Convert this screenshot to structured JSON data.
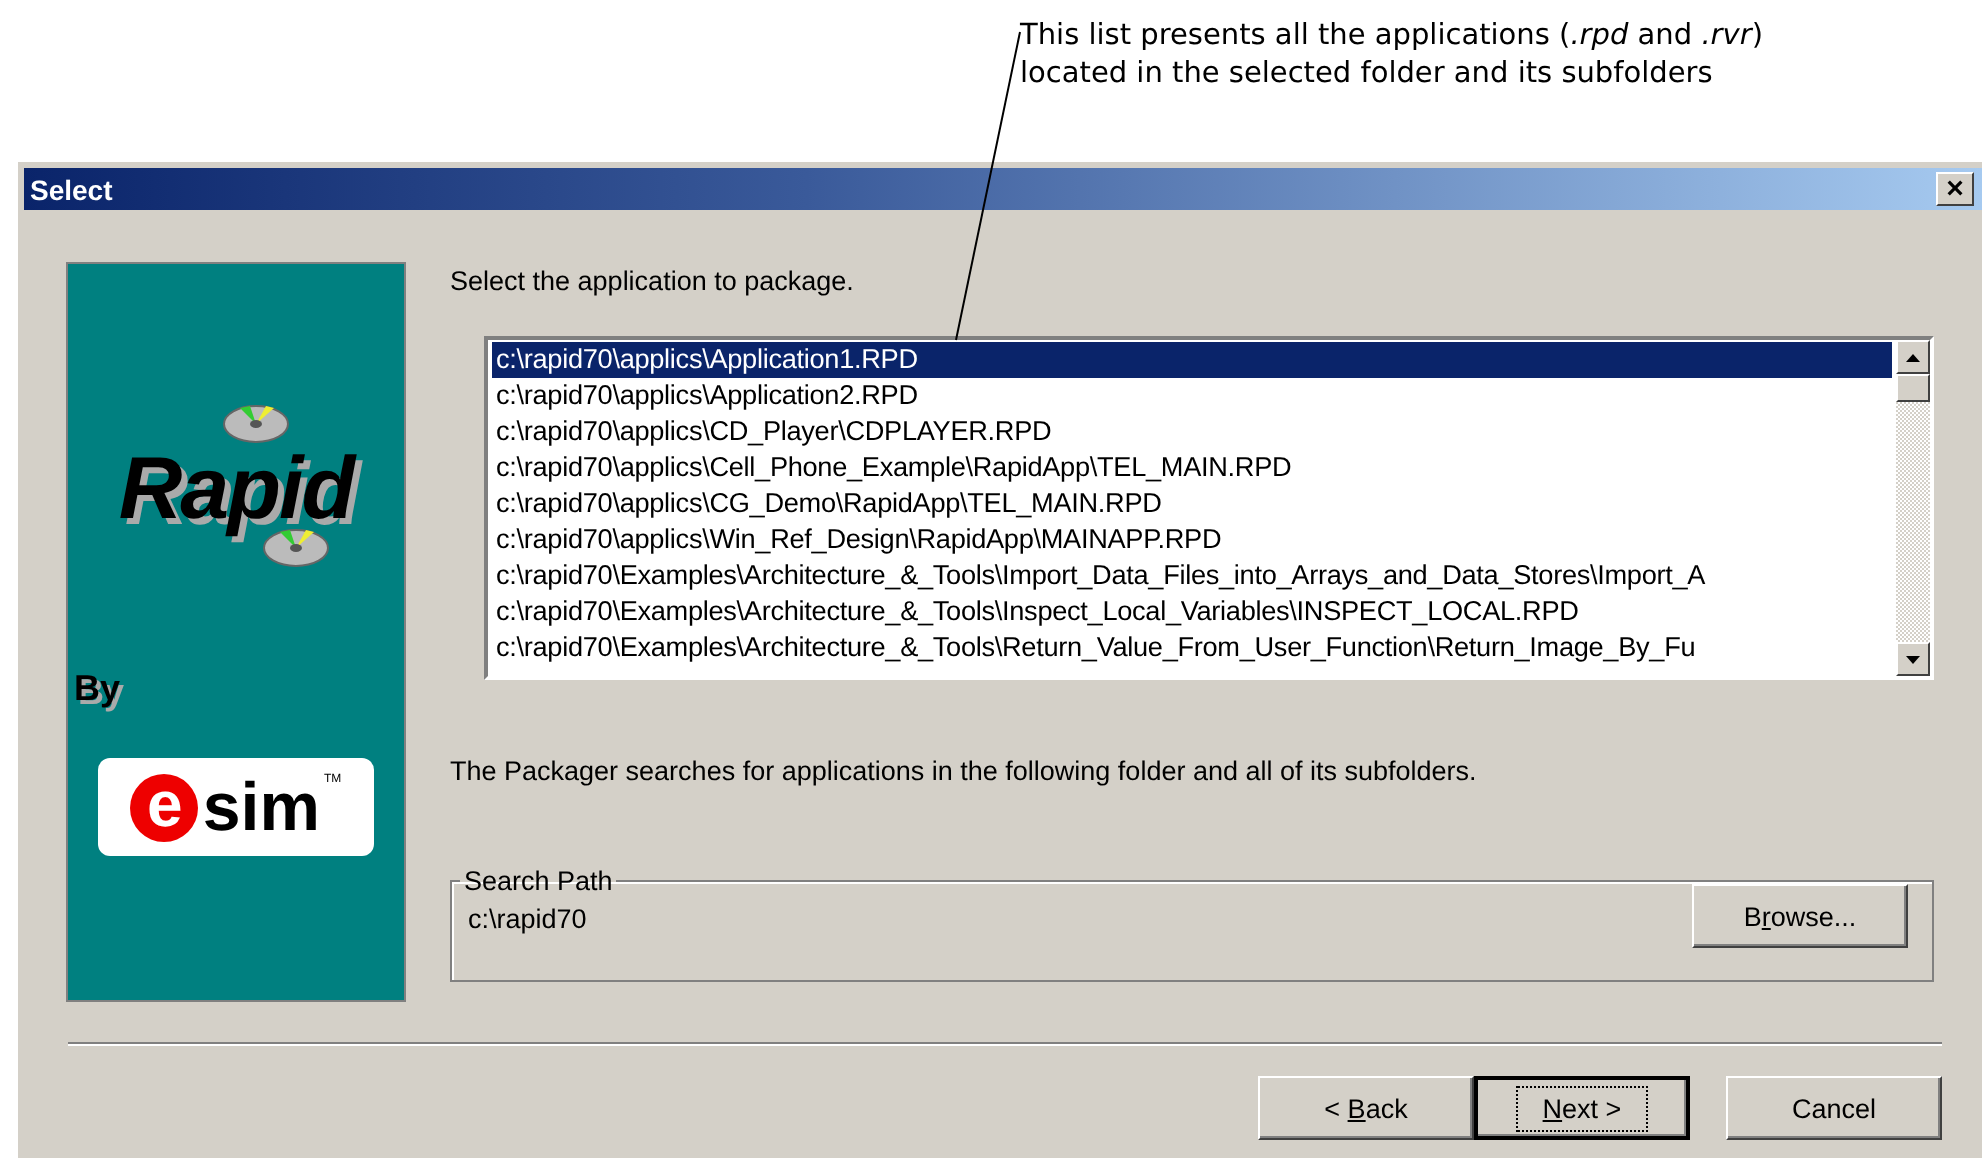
{
  "callout": {
    "text": "This list presents all the applications (*.rpd* and *.rvr*)\nlocated in the selected folder and its subfolders"
  },
  "window": {
    "title": "Select",
    "close": "×"
  },
  "logo": {
    "product": "Rapid",
    "by": "By",
    "brand_mark": "e",
    "brand_name": "sim",
    "trademark": "TM"
  },
  "prompt": "Select the application to package.",
  "applications": [
    {
      "path": "c:\\rapid70\\applics\\Application1.RPD",
      "selected": true
    },
    {
      "path": "c:\\rapid70\\applics\\Application2.RPD",
      "selected": false
    },
    {
      "path": "c:\\rapid70\\applics\\CD_Player\\CDPLAYER.RPD",
      "selected": false
    },
    {
      "path": "c:\\rapid70\\applics\\Cell_Phone_Example\\RapidApp\\TEL_MAIN.RPD",
      "selected": false
    },
    {
      "path": "c:\\rapid70\\applics\\CG_Demo\\RapidApp\\TEL_MAIN.RPD",
      "selected": false
    },
    {
      "path": "c:\\rapid70\\applics\\Win_Ref_Design\\RapidApp\\MAINAPP.RPD",
      "selected": false
    },
    {
      "path": "c:\\rapid70\\Examples\\Architecture_&_Tools\\Import_Data_Files_into_Arrays_and_Data_Stores\\Import_A",
      "selected": false
    },
    {
      "path": "c:\\rapid70\\Examples\\Architecture_&_Tools\\Inspect_Local_Variables\\INSPECT_LOCAL.RPD",
      "selected": false
    },
    {
      "path": "c:\\rapid70\\Examples\\Architecture_&_Tools\\Return_Value_From_User_Function\\Return_Image_By_Fu",
      "selected": false
    }
  ],
  "info": "The Packager searches for applications in the following folder and all of its subfolders.",
  "search_path": {
    "legend": "Search Path",
    "value": "c:\\rapid70",
    "button": {
      "before": "B",
      "mnemonic": "r",
      "after": "owse..."
    }
  },
  "buttons": [
    {
      "before": "< ",
      "mnemonic": "B",
      "after": "ack",
      "default": false
    },
    {
      "mnemonic": "N",
      "after": "ext >",
      "default": true
    },
    {
      "before": "Cancel",
      "default": false
    }
  ]
}
